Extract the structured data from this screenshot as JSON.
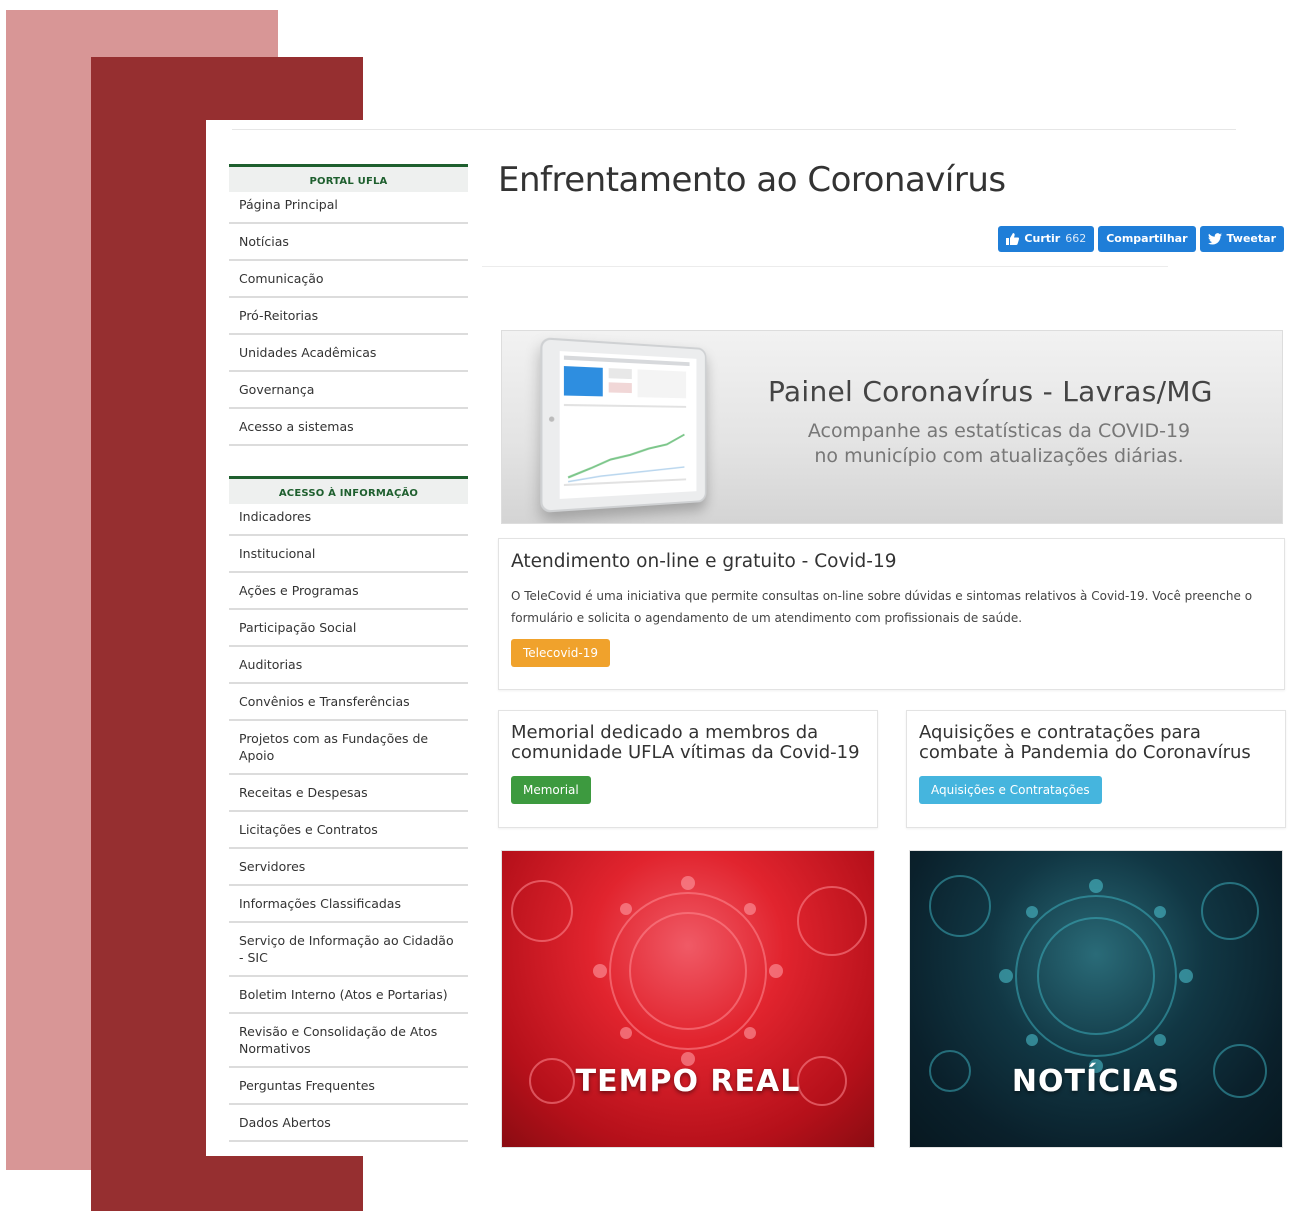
{
  "sidebar": {
    "portal": {
      "header": "PORTAL UFLA",
      "items": [
        "Página Principal",
        "Notícias",
        "Comunicação",
        "Pró-Reitorias",
        "Unidades Acadêmicas",
        "Governança",
        "Acesso a sistemas"
      ]
    },
    "acesso": {
      "header": "ACESSO À INFORMAÇÃO",
      "items": [
        "Indicadores",
        "Institucional",
        "Ações e Programas",
        "Participação Social",
        "Auditorias",
        "Convênios e Transferências",
        "Projetos com as Fundações de Apoio",
        "Receitas e Despesas",
        "Licitações e Contratos",
        "Servidores",
        "Informações Classificadas",
        "Serviço de Informação ao Cidadão - SIC",
        "Boletim Interno (Atos e Portarias)",
        "Revisão e Consolidação de Atos Normativos",
        "Perguntas Frequentes",
        "Dados Abertos"
      ]
    }
  },
  "main": {
    "title": "Enfrentamento ao Coronavírus",
    "social": {
      "like_label": "Curtir",
      "like_count": "662",
      "share_label": "Compartilhar",
      "tweet_label": "Tweetar"
    },
    "banner": {
      "title": "Painel Coronavírus - Lavras/MG",
      "subtitle_line1": "Acompanhe as estatísticas da COVID-19",
      "subtitle_line2": "no município com atualizações diárias."
    },
    "telecovid": {
      "title": "Atendimento on-line e gratuito - Covid-19",
      "text": "O TeleCovid é uma iniciativa que permite consultas on-line sobre dúvidas e sintomas relativos à Covid-19. Você preenche o formulário e solicita o agendamento de um atendimento com profissionais de saúde.",
      "button": "Telecovid-19"
    },
    "memorial": {
      "title": "Memorial dedicado a membros da comunidade UFLA vítimas da Covid-19",
      "button": "Memorial"
    },
    "aquisicoes": {
      "title": "Aquisições e contratações para combate à Pandemia do Coronavírus",
      "button": "Aquisições e Contratações"
    },
    "promo_realtime": "TEMPO REAL",
    "promo_news": "NOTÍCIAS"
  },
  "colors": {
    "sidebar_accent": "#1e5f2e",
    "deco_pink": "#d89696",
    "deco_dark": "#962f30",
    "social_blue": "#1f7ed8",
    "orange": "#f0a22c",
    "green": "#3d9a3f",
    "cyan": "#45b5de"
  },
  "icons": {
    "like": "thumbs-up-icon",
    "tweet": "twitter-bird-icon"
  }
}
